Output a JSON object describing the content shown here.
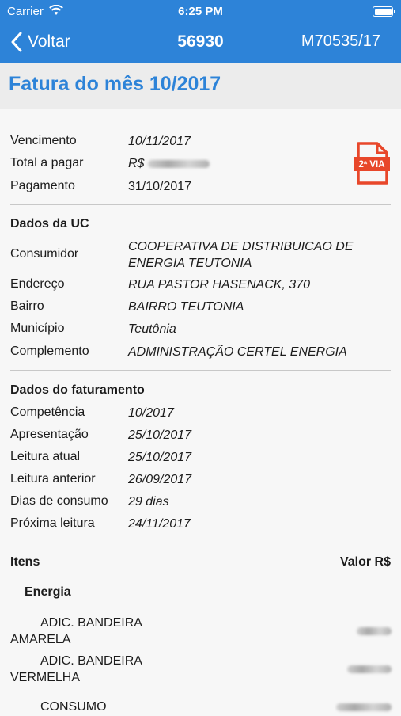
{
  "status": {
    "carrier": "Carrier",
    "time": "6:25 PM"
  },
  "nav": {
    "back_label": "Voltar",
    "title": "56930",
    "right": "M70535/17"
  },
  "page_title": "Fatura do mês 10/2017",
  "summary": {
    "vencimento_label": "Vencimento",
    "vencimento": "10/11/2017",
    "total_label": "Total a pagar",
    "total_prefix": "R$",
    "pagamento_label": "Pagamento",
    "pagamento": "31/10/2017",
    "pdf_badge": "2ª VIA"
  },
  "uc": {
    "heading": "Dados da UC",
    "consumidor_label": "Consumidor",
    "consumidor": "COOPERATIVA DE DISTRIBUICAO DE ENERGIA TEUTONIA",
    "endereco_label": "Endereço",
    "endereco": "RUA PASTOR HASENACK, 370",
    "bairro_label": "Bairro",
    "bairro": "BAIRRO TEUTONIA",
    "municipio_label": "Município",
    "municipio": "Teutônia",
    "complemento_label": "Complemento",
    "complemento": "ADMINISTRAÇÃO CERTEL ENERGIA"
  },
  "faturamento": {
    "heading": "Dados do faturamento",
    "competencia_label": "Competência",
    "competencia": "10/2017",
    "apresentacao_label": "Apresentação",
    "apresentacao": "25/10/2017",
    "leitura_atual_label": "Leitura atual",
    "leitura_atual": "25/10/2017",
    "leitura_anterior_label": "Leitura anterior",
    "leitura_anterior": "26/09/2017",
    "dias_label": "Dias de consumo",
    "dias": "29 dias",
    "proxima_label": "Próxima leitura",
    "proxima": "24/11/2017"
  },
  "itens": {
    "heading": "Itens",
    "valor_header": "Valor R$",
    "group": "Energia",
    "items": [
      {
        "line1": "ADIC. BANDEIRA",
        "line2": "AMARELA"
      },
      {
        "line1": "ADIC. BANDEIRA",
        "line2": "VERMELHA"
      },
      {
        "line1": "CONSUMO",
        "line2": ""
      }
    ]
  }
}
